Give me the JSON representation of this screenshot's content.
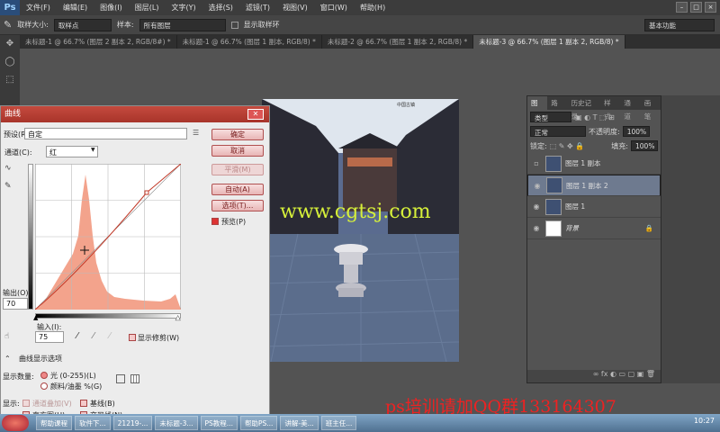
{
  "app": {
    "logo": "Ps"
  },
  "menu": [
    "文件(F)",
    "编辑(E)",
    "图像(I)",
    "图层(L)",
    "文字(Y)",
    "选择(S)",
    "滤镜(T)",
    "视图(V)",
    "窗口(W)",
    "帮助(H)"
  ],
  "options": {
    "sample_size_label": "取样大小:",
    "sample_size_value": "取样点",
    "sample_label": "样本:",
    "sample_value": "所有图层",
    "show_ring_label": "显示取样环",
    "workspace_value": "基本功能"
  },
  "tabs": [
    {
      "label": "未标题-1 @ 66.7% (图层 2 副本 2, RGB/8#) *",
      "active": false
    },
    {
      "label": "未标题-1 @ 66.7% (图层 1 副本, RGB/8) *",
      "active": false
    },
    {
      "label": "未标题-2 @ 66.7% (图层 1 副本 2, RGB/8) *",
      "active": false
    },
    {
      "label": "未标题-3 @ 66.7% (图层 1 副本 2, RGB/8) *",
      "active": true
    }
  ],
  "photo": {
    "watermark": "www.cgtsj.com",
    "caption": "中国古镇"
  },
  "curves": {
    "title": "曲线",
    "preset_label": "预设(R):",
    "preset_value": "自定",
    "channel_label": "通道(C):",
    "channel_value": "红",
    "output_label": "输出(O):",
    "output_value": "70",
    "input_label": "输入(I):",
    "input_value": "75",
    "show_clipping_label": "显示修剪(W)",
    "options_header": "曲线显示选项",
    "show_amount_label": "显示数量:",
    "light_option": "光 (0-255)(L)",
    "pigment_option": "颜料/油墨 %(G)",
    "show_label": "显示:",
    "channel_overlay": "通道叠加(V)",
    "baseline": "基线(B)",
    "histogram": "直方图(H)",
    "intersection": "交叉线(N)",
    "buttons": {
      "ok": "确定",
      "cancel": "取消",
      "smooth": "平滑(M)",
      "auto": "自动(A)",
      "options": "选项(T)...",
      "preview": "预览(P)"
    }
  },
  "layers": {
    "tabs": [
      "图层",
      "路径",
      "历史记录",
      "样式",
      "通道",
      "画笔"
    ],
    "kind_value": "类型",
    "blend_value": "正常",
    "opacity_label": "不透明度:",
    "opacity_value": "100%",
    "lock_label": "锁定:",
    "fill_label": "填充:",
    "fill_value": "100%",
    "items": [
      {
        "name": "图层 1 副本",
        "visible": false,
        "selected": false
      },
      {
        "name": "图层 1 副本 2",
        "visible": true,
        "selected": true
      },
      {
        "name": "图层 1",
        "visible": true,
        "selected": false
      },
      {
        "name": "背景",
        "visible": true,
        "selected": false
      }
    ]
  },
  "taskbar": {
    "items": [
      "帮助课程",
      "软件下...",
      "21219-...",
      "未标题-3...",
      "PS教程...",
      "帮助PS...",
      "讲解-美...",
      "班主任..."
    ],
    "clock": "10:27"
  },
  "overlay_watermark": "ps培训请加QQ群133164307",
  "colors": {
    "dialog_title": "#c54a3e",
    "histogram": "#f3a38c",
    "selected_layer": "#6e7a8f"
  }
}
